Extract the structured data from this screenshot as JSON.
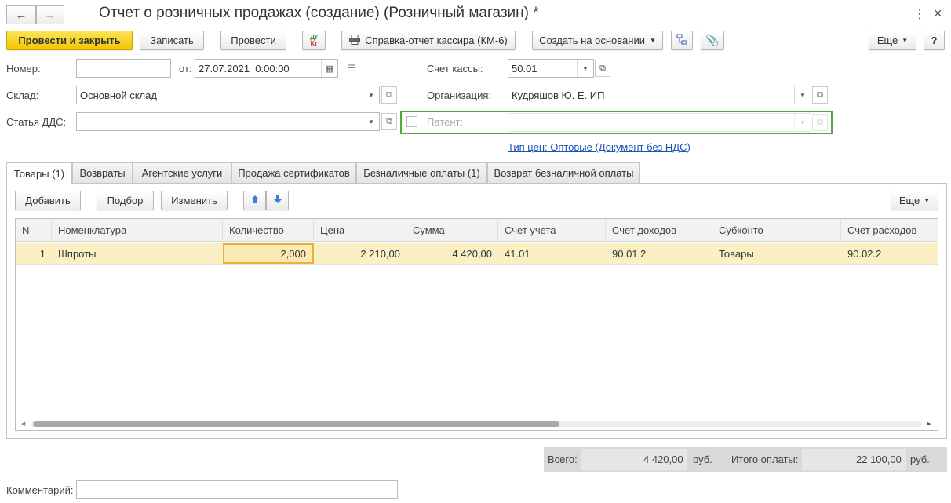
{
  "window": {
    "title": "Отчет о розничных продажах (создание) (Розничный магазин) *"
  },
  "toolbar": {
    "post_close": "Провести и закрыть",
    "save": "Записать",
    "post": "Провести",
    "dtkt_dt": "Дт",
    "dtkt_kt": "Кт",
    "print_report": "Справка-отчет кассира (КМ-6)",
    "create_based": "Создать на основании",
    "more": "Еще",
    "help": "?"
  },
  "form": {
    "number_label": "Номер:",
    "number_value": "",
    "date_label": "от:",
    "date_value": "27.07.2021  0:00:00",
    "cash_account_label": "Счет кассы:",
    "cash_account_value": "50.01",
    "warehouse_label": "Склад:",
    "warehouse_value": "Основной склад",
    "org_label": "Организация:",
    "org_value": "Кудряшов Ю. Е. ИП",
    "dds_label": "Статья ДДС:",
    "dds_value": "",
    "patent_label": "Патент:",
    "patent_value": "",
    "price_type_link": "Тип цен: Оптовые (Документ без НДС)"
  },
  "tabs": [
    {
      "label": "Товары (1)"
    },
    {
      "label": "Возвраты"
    },
    {
      "label": "Агентские услуги"
    },
    {
      "label": "Продажа сертификатов"
    },
    {
      "label": "Безналичные оплаты (1)"
    },
    {
      "label": "Возврат безналичной оплаты"
    }
  ],
  "table_toolbar": {
    "add": "Добавить",
    "pick": "Подбор",
    "change": "Изменить",
    "more": "Еще"
  },
  "table": {
    "headers": [
      "N",
      "Номенклатура",
      "Количество",
      "Цена",
      "Сумма",
      "Счет учета",
      "Счет доходов",
      "Субконто",
      "Счет расходов"
    ],
    "rows": [
      [
        "1",
        "Шпроты",
        "2,000",
        "2 210,00",
        "4 420,00",
        "41.01",
        "90.01.2",
        "Товары",
        "90.02.2"
      ]
    ]
  },
  "totals": {
    "total_label": "Всего:",
    "total_value": "4 420,00",
    "total_currency": "руб.",
    "paid_label": "Итого оплаты:",
    "paid_value": "22 100,00",
    "paid_currency": "руб."
  },
  "comment": {
    "label": "Комментарий:",
    "value": ""
  },
  "colors": {
    "primary_button": "#f2c600",
    "selected_row": "#fbf0c4",
    "active_cell_border": "#e9b13c",
    "patent_border": "#4cab3a",
    "link": "#1a52b5"
  }
}
